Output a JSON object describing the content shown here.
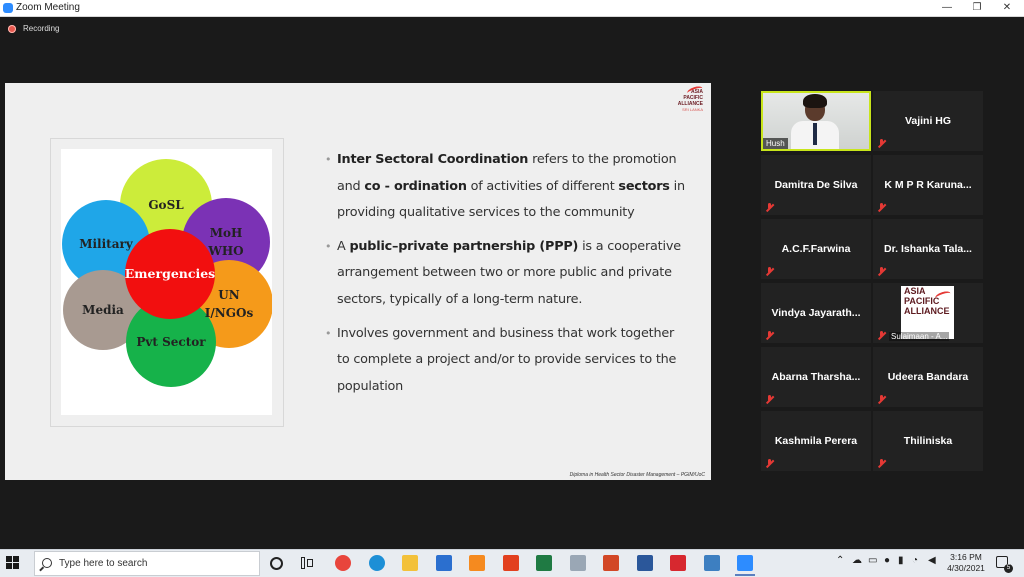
{
  "window": {
    "title": "Zoom Meeting",
    "controls": [
      "—",
      "❐",
      "✕"
    ]
  },
  "recording": {
    "label": "Recording"
  },
  "slide": {
    "logo": {
      "line1": "ASIA",
      "line2": "PACIFIC",
      "line3": "ALLIANCE",
      "line4": "SRI LANKA"
    },
    "diagram": {
      "circles": [
        {
          "label": "GoSL",
          "color": "#ccec3a",
          "text_color": "#222"
        },
        {
          "label": "Military",
          "color": "#1fa6e8",
          "text_color": "#222"
        },
        {
          "label": "MoH",
          "label2": "WHO",
          "color": "#7b32b5",
          "text_color": "#222"
        },
        {
          "label": "UN",
          "label2": "I/NGOs",
          "color": "#f59a1a",
          "text_color": "#222"
        },
        {
          "label": "Media",
          "color": "#a89a91",
          "text_color": "#222"
        },
        {
          "label": "Pvt Sector",
          "color": "#16b24a",
          "text_color": "#222"
        },
        {
          "label": "Emergencies",
          "color": "#f20f0f",
          "text_color": "#ffffff"
        }
      ]
    },
    "bullets": [
      {
        "parts": [
          {
            "b": "Inter Sectoral Coordination"
          },
          {
            "t": " refers to the promotion and "
          },
          {
            "b": "co - ordination"
          },
          {
            "t": " of activities of different "
          },
          {
            "b": "sectors"
          },
          {
            "t": " in providing qualitative services to the community"
          }
        ]
      },
      {
        "parts": [
          {
            "t": "A "
          },
          {
            "b": "public–private partnership (PPP)"
          },
          {
            "t": " is a cooperative arrangement between two or more public and private sectors, typically of a long-term nature."
          }
        ]
      },
      {
        "parts": [
          {
            "t": "Involves government and business that work together to complete a project and/or to provide services to the population"
          }
        ]
      }
    ],
    "footer": "Diploma in Health Sector Disaster Management – PGIM/UoC"
  },
  "participants": {
    "video": {
      "name": "Hush"
    },
    "tiles": [
      {
        "name": "Vajini HG"
      },
      {
        "name": "Damitra De Silva"
      },
      {
        "name": "K M P R Karuna..."
      },
      {
        "name": "A.C.F.Farwina"
      },
      {
        "name": "Dr. Ishanka Tala..."
      },
      {
        "name": "Vindya Jayarath..."
      },
      {
        "name": "Sulaimaan - A...",
        "logo": [
          "ASIA",
          "PACIFIC",
          "ALLIANCE"
        ]
      },
      {
        "name": "Abarna Tharsha..."
      },
      {
        "name": "Udeera Bandara"
      },
      {
        "name": "Kashmila Perera"
      },
      {
        "name": "Thiliniska"
      }
    ]
  },
  "taskbar": {
    "search_placeholder": "Type here to search",
    "apps": [
      {
        "name": "chrome-icon",
        "color": "#e8453c"
      },
      {
        "name": "edge-icon",
        "color": "#1d8fd6"
      },
      {
        "name": "file-explorer-icon",
        "color": "#f3c13a"
      },
      {
        "name": "mail-icon",
        "color": "#2b6fcf"
      },
      {
        "name": "vlc-icon",
        "color": "#f58a1f"
      },
      {
        "name": "office-icon",
        "color": "#e2401f"
      },
      {
        "name": "excel-icon",
        "color": "#1f7a43"
      },
      {
        "name": "paint-icon",
        "color": "#9aa7b5"
      },
      {
        "name": "powerpoint-icon",
        "color": "#d24726"
      },
      {
        "name": "word-icon",
        "color": "#2b579a"
      },
      {
        "name": "acrobat-icon",
        "color": "#d7282f"
      },
      {
        "name": "photos-icon",
        "color": "#3d7fc1"
      },
      {
        "name": "zoom-icon",
        "color": "#2d8cff"
      }
    ],
    "time": "3:16 PM",
    "date": "4/30/2021",
    "notifications": "5"
  }
}
